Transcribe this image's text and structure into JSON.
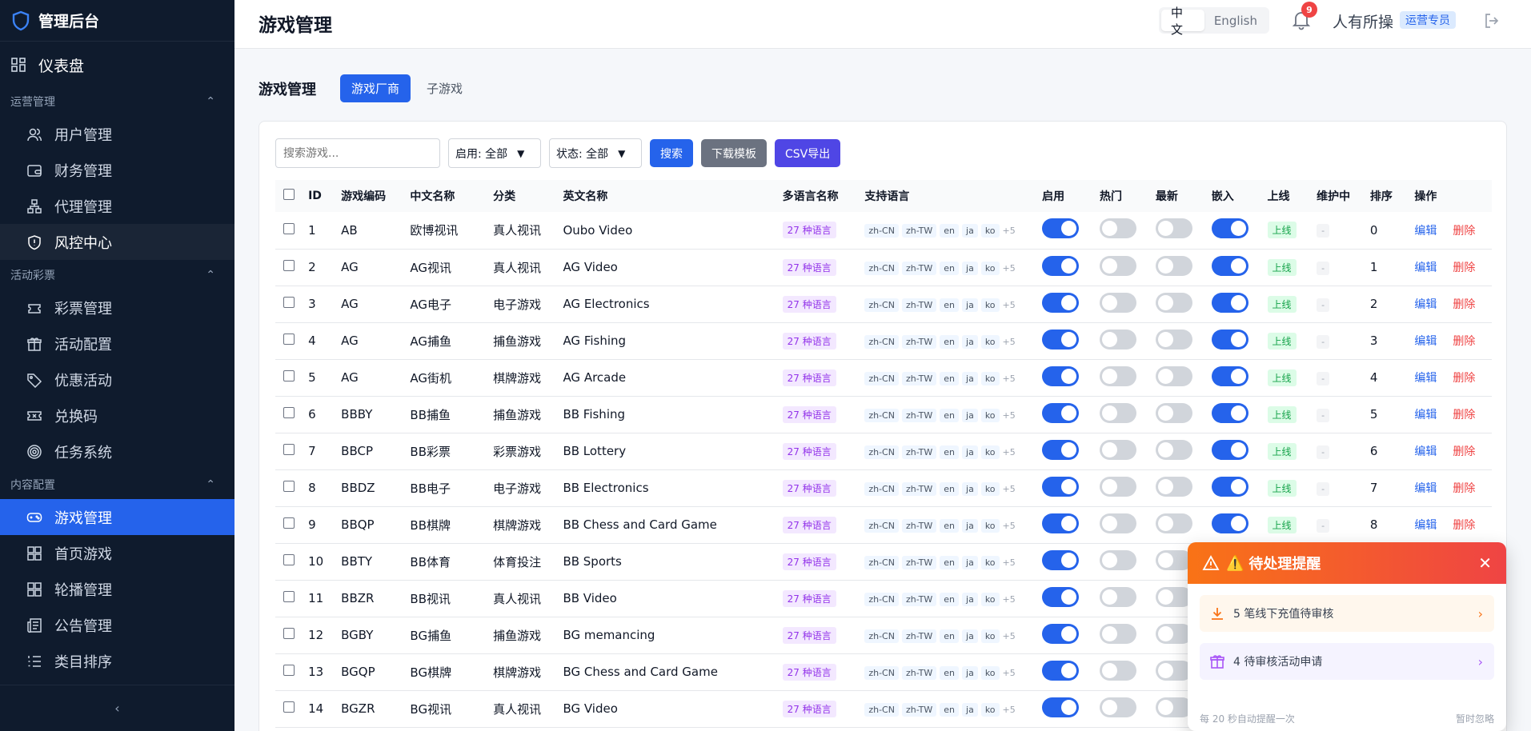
{
  "sidebar": {
    "brand": "管理后台",
    "dashboard": "仪表盘",
    "groups": [
      {
        "label": "运营管理",
        "items": [
          "用户管理",
          "财务管理",
          "代理管理",
          "风控中心"
        ]
      },
      {
        "label": "活动彩票",
        "items": [
          "彩票管理",
          "活动配置",
          "优惠活动",
          "兑换码",
          "任务系统"
        ]
      },
      {
        "label": "内容配置",
        "items": [
          "游戏管理",
          "首页游戏",
          "轮播管理",
          "公告管理",
          "类目排序"
        ]
      }
    ],
    "collapse_label": "‹"
  },
  "header": {
    "title": "游戏管理",
    "lang_zh": "中文",
    "lang_en": "English",
    "notification_count": "9",
    "user_name": "人有所操",
    "role": "运营专员"
  },
  "subbar": {
    "title": "游戏管理",
    "tabs": [
      "游戏厂商",
      "子游戏"
    ]
  },
  "filters": {
    "search_placeholder": "搜索游戏...",
    "enabled_select": "启用: 全部",
    "status_select": "状态: 全部",
    "search_btn": "搜索",
    "download_btn": "下载模板",
    "export_btn": "CSV导出"
  },
  "table": {
    "headers": [
      "ID",
      "游戏编码",
      "中文名称",
      "分类",
      "英文名称",
      "多语言名称",
      "支持语言",
      "启用",
      "热门",
      "最新",
      "嵌入",
      "上线",
      "维护中",
      "排序",
      "操作"
    ],
    "lang_count": "27 种语言",
    "lang_tags": [
      "zh-CN",
      "zh-TW",
      "en",
      "ja",
      "ko"
    ],
    "lang_more": "+5",
    "online_label": "上线",
    "maint_label": "-",
    "edit_label": "编辑",
    "delete_label": "删除",
    "rows": [
      {
        "id": "1",
        "code": "AB",
        "cn": "欧博视讯",
        "cat": "真人视讯",
        "en": "Oubo Video",
        "sort": "0"
      },
      {
        "id": "2",
        "code": "AG",
        "cn": "AG视讯",
        "cat": "真人视讯",
        "en": "AG Video",
        "sort": "1"
      },
      {
        "id": "3",
        "code": "AG",
        "cn": "AG电子",
        "cat": "电子游戏",
        "en": "AG Electronics",
        "sort": "2"
      },
      {
        "id": "4",
        "code": "AG",
        "cn": "AG捕鱼",
        "cat": "捕鱼游戏",
        "en": "AG Fishing",
        "sort": "3"
      },
      {
        "id": "5",
        "code": "AG",
        "cn": "AG街机",
        "cat": "棋牌游戏",
        "en": "AG Arcade",
        "sort": "4"
      },
      {
        "id": "6",
        "code": "BBBY",
        "cn": "BB捕鱼",
        "cat": "捕鱼游戏",
        "en": "BB Fishing",
        "sort": "5"
      },
      {
        "id": "7",
        "code": "BBCP",
        "cn": "BB彩票",
        "cat": "彩票游戏",
        "en": "BB Lottery",
        "sort": "6"
      },
      {
        "id": "8",
        "code": "BBDZ",
        "cn": "BB电子",
        "cat": "电子游戏",
        "en": "BB Electronics",
        "sort": "7"
      },
      {
        "id": "9",
        "code": "BBQP",
        "cn": "BB棋牌",
        "cat": "棋牌游戏",
        "en": "BB Chess and Card Game",
        "sort": "8"
      },
      {
        "id": "10",
        "code": "BBTY",
        "cn": "BB体育",
        "cat": "体育投注",
        "en": "BB Sports",
        "sort": ""
      },
      {
        "id": "11",
        "code": "BBZR",
        "cn": "BB视讯",
        "cat": "真人视讯",
        "en": "BB Video",
        "sort": ""
      },
      {
        "id": "12",
        "code": "BGBY",
        "cn": "BG捕鱼",
        "cat": "捕鱼游戏",
        "en": "BG memancing",
        "sort": ""
      },
      {
        "id": "13",
        "code": "BGQP",
        "cn": "BG棋牌",
        "cat": "棋牌游戏",
        "en": "BG Chess and Card Game",
        "sort": ""
      },
      {
        "id": "14",
        "code": "BGZR",
        "cn": "BG视讯",
        "cat": "真人视讯",
        "en": "BG Video",
        "sort": ""
      }
    ]
  },
  "popup": {
    "title": "待处理提醒",
    "items": [
      "5 笔线下充值待审核",
      "4 待审核活动申请"
    ],
    "footer_left": "每 20 秒自动提醒一次",
    "footer_right": "暂时忽略"
  },
  "colors": {
    "accent": "#2563eb",
    "sidebar": "#0f1b2d",
    "danger": "#ef4444"
  }
}
